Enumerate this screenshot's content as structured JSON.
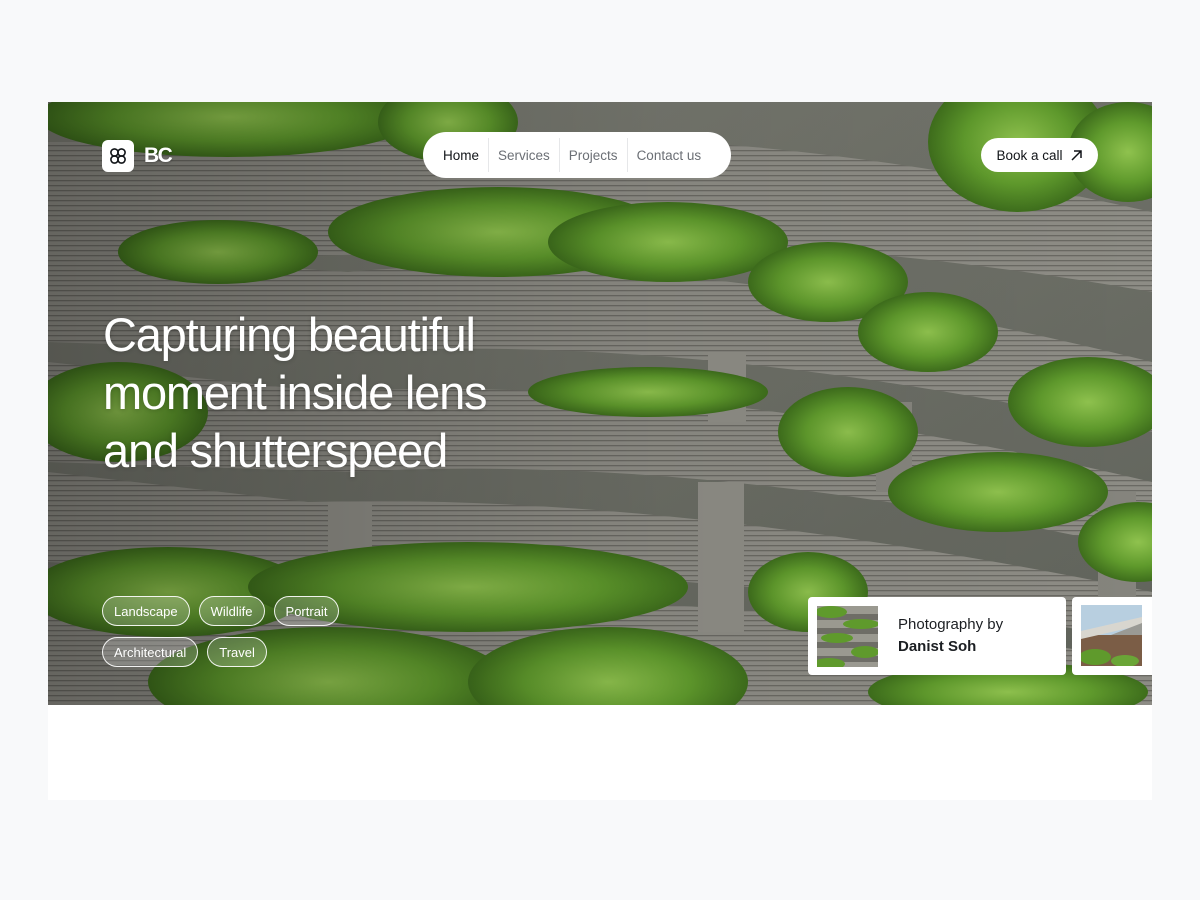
{
  "brand": {
    "logo_text": "BC",
    "logo_icon": "clover-icon"
  },
  "nav": {
    "items": [
      {
        "label": "Home",
        "active": true
      },
      {
        "label": "Services",
        "active": false
      },
      {
        "label": "Projects",
        "active": false
      },
      {
        "label": "Contact us",
        "active": false
      }
    ]
  },
  "cta": {
    "label": "Book a call",
    "icon": "arrow-up-right-icon"
  },
  "hero": {
    "headline_lines": [
      "Capturing beautiful",
      "moment inside lens",
      "and shutterspeed"
    ]
  },
  "tags": [
    {
      "label": "Landscape"
    },
    {
      "label": "Wildlife"
    },
    {
      "label": "Portrait"
    },
    {
      "label": "Architectural"
    },
    {
      "label": "Travel"
    }
  ],
  "photographer_card": {
    "line1": "Photography by",
    "line2": "Danist Soh"
  },
  "colors": {
    "page_bg": "#f8f9fa",
    "accent_text": "#111418",
    "foliage": "#6a9a3a",
    "concrete": "#8a8a82"
  }
}
